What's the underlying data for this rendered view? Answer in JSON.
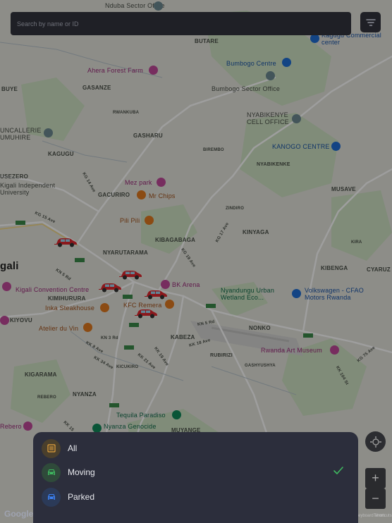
{
  "search": {
    "placeholder": "Search by name or ID"
  },
  "filter_button": {
    "icon": "filter-icon"
  },
  "map": {
    "places": [
      {
        "text": "Nduba Sector Office"
      },
      {
        "text": "BUTARE"
      },
      {
        "text": "Kagugu Commercial center"
      },
      {
        "text": "Ahera Forest Farm"
      },
      {
        "text": "Bumbogo Centre"
      },
      {
        "text": "Bumbogo Sector Office"
      },
      {
        "text": "BUYE"
      },
      {
        "text": "GASANZE"
      },
      {
        "text": "RWANKUBA"
      },
      {
        "text": "NYABIKENYE CELL OFFICE"
      },
      {
        "text": "UNCALLERIE UMUHIRE"
      },
      {
        "text": "GASHARU"
      },
      {
        "text": "KAGUGU"
      },
      {
        "text": "BIREMBO"
      },
      {
        "text": "KANOGO CENTRE"
      },
      {
        "text": "NYABIKENKE"
      },
      {
        "text": "USEZERO"
      },
      {
        "text": "Kigali Independent University"
      },
      {
        "text": "Mez park"
      },
      {
        "text": "GACURIRO"
      },
      {
        "text": "Mr Chips"
      },
      {
        "text": "MUSAVE"
      },
      {
        "text": "ZINDIRO"
      },
      {
        "text": "Pili Pili"
      },
      {
        "text": "KIBAGABAGA"
      },
      {
        "text": "KINYAGA"
      },
      {
        "text": "NYARUTARAMA"
      },
      {
        "text": "gali"
      },
      {
        "text": "KIBENGA"
      },
      {
        "text": "CYARUZ"
      },
      {
        "text": "BK Arena"
      },
      {
        "text": "Kigali Convention Centre"
      },
      {
        "text": "Nyandungu Urban Wetland Eco..."
      },
      {
        "text": "Volkswagen - CFAO Motors Rwanda"
      },
      {
        "text": "KIMIHURURA"
      },
      {
        "text": "Inka Steakhouse"
      },
      {
        "text": "KFC Remera"
      },
      {
        "text": "KIYOVU"
      },
      {
        "text": "Atelier du Vin"
      },
      {
        "text": "NONKO"
      },
      {
        "text": "KABEZA"
      },
      {
        "text": "Rwanda Art Museum"
      },
      {
        "text": "RUBIRIZI"
      },
      {
        "text": "GASHYUSHYA"
      },
      {
        "text": "KICUKIRO"
      },
      {
        "text": "KIGARAMA"
      },
      {
        "text": "NYANZA"
      },
      {
        "text": "REBERO"
      },
      {
        "text": "Tequila Paradiso"
      },
      {
        "text": "Nyanza Genocide"
      },
      {
        "text": "MUYANGE"
      },
      {
        "text": "Rebero"
      },
      {
        "text": "KIRA"
      }
    ],
    "roads": [
      {
        "text": "KG 14 Ave"
      },
      {
        "text": "KG 15 Ave"
      },
      {
        "text": "KN 5 Rd"
      },
      {
        "text": "KG 19 Ave"
      },
      {
        "text": "KG 17 Ave"
      },
      {
        "text": "KN 3 Rd"
      },
      {
        "text": "KK 8 Ave"
      },
      {
        "text": "KK 34 Ave"
      },
      {
        "text": "KK 21 Ave"
      },
      {
        "text": "KK 19 Ave"
      },
      {
        "text": "KK 18 Ave"
      },
      {
        "text": "KN 5 Rd"
      },
      {
        "text": "KG 75 Ave"
      },
      {
        "text": "KK 104 St"
      },
      {
        "text": "KK 15"
      }
    ],
    "vehicles": [
      {
        "icon": "car-icon"
      },
      {
        "icon": "car-icon"
      },
      {
        "icon": "car-icon"
      },
      {
        "icon": "car-icon"
      },
      {
        "icon": "car-icon"
      }
    ]
  },
  "map_controls": {
    "zoom_in": "+",
    "zoom_out": "−"
  },
  "attribution": {
    "logo": "Google",
    "terms": "Terms",
    "keyboard": "Keyboard shortcuts"
  },
  "filter_sheet": {
    "options": [
      {
        "label": "All",
        "icon": "list-icon",
        "color": "#e8a33d",
        "selected": false
      },
      {
        "label": "Moving",
        "icon": "car-icon",
        "color": "#3fb960",
        "selected": true
      },
      {
        "label": "Parked",
        "icon": "car-icon",
        "color": "#3b82f6",
        "selected": false
      }
    ],
    "check_color": "#3fb960"
  }
}
